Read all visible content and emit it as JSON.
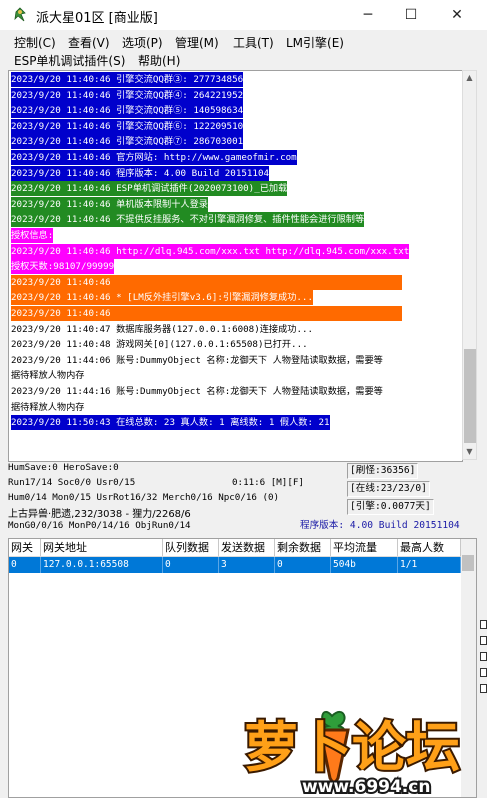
{
  "window": {
    "title": "派大星01区 [商业版]",
    "minimize_glyph": "─",
    "maximize_glyph": "☐",
    "close_glyph": "✕"
  },
  "menu": {
    "row1": [
      "控制(C)",
      "查看(V)",
      "选项(P)",
      "管理(M)",
      "工具(T)",
      "LM引擎(E)"
    ],
    "row2": [
      "ESP单机调试插件(S)",
      "帮助(H)"
    ]
  },
  "log": {
    "lines": [
      {
        "text": "2023/9/20 11:40:46 引擎交流QQ群③: 277734856",
        "fg": "#ffffff",
        "bg": "#0000cc"
      },
      {
        "text": "2023/9/20 11:40:46 引擎交流QQ群④: 264221952",
        "fg": "#ffffff",
        "bg": "#0000cc"
      },
      {
        "text": "2023/9/20 11:40:46 引擎交流QQ群⑤: 140598634",
        "fg": "#ffffff",
        "bg": "#0000cc"
      },
      {
        "text": "2023/9/20 11:40:46 引擎交流QQ群⑥: 122209510",
        "fg": "#ffffff",
        "bg": "#0000cc"
      },
      {
        "text": "2023/9/20 11:40:46 引擎交流QQ群⑦: 286703001",
        "fg": "#ffffff",
        "bg": "#0000cc"
      },
      {
        "text": "2023/9/20 11:40:46 官方网站: http://www.gameofmir.com",
        "fg": "#ffffff",
        "bg": "#0000cc"
      },
      {
        "text": "2023/9/20 11:40:46 程序版本: 4.00 Build 20151104",
        "fg": "#ffffff",
        "bg": "#0000cc"
      },
      {
        "text": "2023/9/20 11:40:46 ESP单机调试插件(2020073100)_已加载",
        "fg": "#ffffff",
        "bg": "#228b22"
      },
      {
        "text": "2023/9/20 11:40:46 单机版本限制十人登录",
        "fg": "#ffffff",
        "bg": "#228b22"
      },
      {
        "text": "2023/9/20 11:40:46 不提供反挂服务、不对引擎漏洞修复、插件性能会进行限制等",
        "fg": "#ffffff",
        "bg": "#228b22"
      },
      {
        "text": "授权信息:",
        "fg": "#ffffff",
        "bg": "#ff00ff"
      },
      {
        "text": "2023/9/20 11:40:46 http://dlq.945.com/xxx.txt http://dlq.945.com/xxx.txt",
        "fg": "#ffffff",
        "bg": "#ff00ff"
      },
      {
        "text": "授权天数:98107/99999",
        "fg": "#ffffff",
        "bg": "#ff00ff"
      },
      {
        "text": "2023/9/20 11:40:46",
        "fg": "#ffffff",
        "bg": "#ff6a00",
        "bar": true
      },
      {
        "text": "2023/9/20 11:40:46 * [LM反外挂引擎v3.6]:引擎漏洞修复成功...",
        "fg": "#ffffff",
        "bg": "#ff6a00"
      },
      {
        "text": "2023/9/20 11:40:46",
        "fg": "#ffffff",
        "bg": "#ff6a00",
        "bar": true
      },
      {
        "text": "2023/9/20 11:40:47 数据库服务器(127.0.0.1:6008)连接成功...",
        "fg": "#000000",
        "bg": "#ffffff"
      },
      {
        "text": "2023/9/20 11:40:48 游戏网关[0](127.0.0.1:65508)已打开...",
        "fg": "#000000",
        "bg": "#ffffff"
      },
      {
        "text": "2023/9/20 11:44:06 账号:DummyObject 名称:龙御天下 人物登陆读取数据，需要等",
        "fg": "#000000",
        "bg": "#ffffff"
      },
      {
        "text": "据待释放人物内存",
        "fg": "#000000",
        "bg": "#ffffff"
      },
      {
        "text": "2023/9/20 11:44:16 账号:DummyObject 名称:龙御天下 人物登陆读取数据，需要等",
        "fg": "#000000",
        "bg": "#ffffff"
      },
      {
        "text": "据待释放人物内存",
        "fg": "#000000",
        "bg": "#ffffff"
      },
      {
        "text": "2023/9/20 11:50:43 在线总数: 23 真人数: 1 离线数: 1 假人数: 21",
        "fg": "#ffffff",
        "bg": "#0000cc"
      }
    ]
  },
  "status": {
    "line1": "HumSave:0 HeroSave:0",
    "line2_left": "Run17/14 Soc0/0 Usr0/15",
    "line2_time": "0:11:6 [M][F]",
    "line3": "Hum0/14 Mon0/15 UsrRot16/32 Merch0/16 Npc0/16 (0)",
    "line4": "上古异兽·肥遗,232/3038 - 狸力/2268/6",
    "line5": "MonG0/0/16 MonP0/14/16 ObjRun0/14",
    "refresh": "[刷怪:36356]",
    "online": "[在线:23/23/0]",
    "engine": "[引擎:0.0077天]",
    "version": "程序版本: 4.00 Build 20151104"
  },
  "gateway_table": {
    "columns": [
      "网关",
      "网关地址",
      "队列数据",
      "发送数据",
      "剩余数据",
      "平均流量",
      "最高人数"
    ],
    "rows": [
      [
        "0",
        "127.0.0.1:65508",
        "0",
        "3",
        "0",
        "504b",
        "1/1"
      ]
    ]
  },
  "watermark": {
    "brand": "萝卜论坛",
    "url": "www.6994.cn"
  },
  "colors": {
    "selected_row": "#0078d7",
    "log_blue": "#0000cc",
    "log_green": "#228b22",
    "log_magenta": "#ff00ff",
    "log_orange": "#ff6a00"
  }
}
